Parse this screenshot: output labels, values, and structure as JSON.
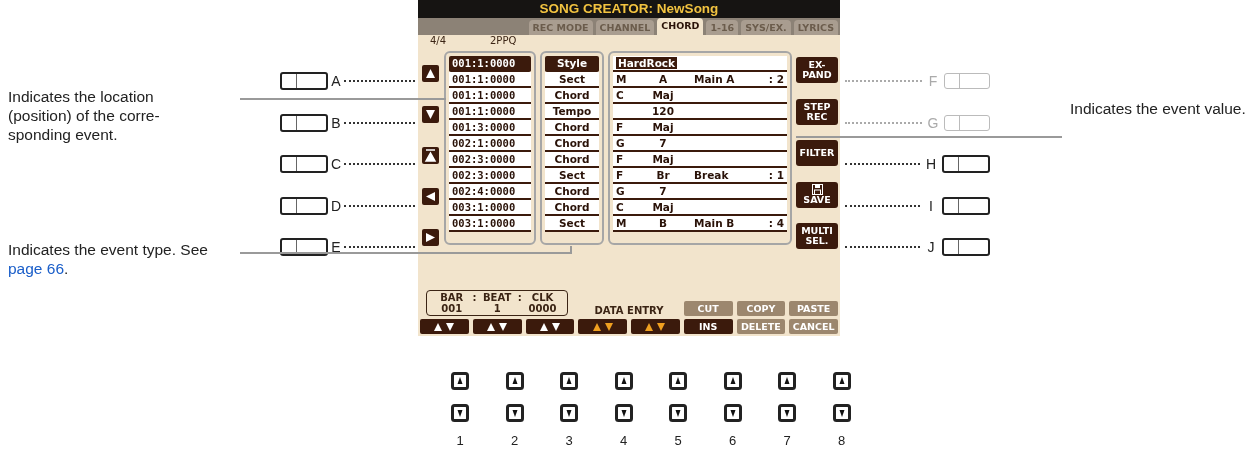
{
  "callouts": [
    {
      "lines": [
        "Indicates the location",
        "(position) of the corre-",
        "sponding event."
      ]
    },
    {
      "lines": [
        "Indicates the event type. See"
      ],
      "link": "page 66",
      "after": "."
    },
    {
      "lines": [
        "Indicates the event value."
      ]
    }
  ],
  "left_buttons": [
    {
      "letter": "A",
      "disabled": false
    },
    {
      "letter": "B",
      "disabled": false
    },
    {
      "letter": "C",
      "disabled": false
    },
    {
      "letter": "D",
      "disabled": false
    },
    {
      "letter": "E",
      "disabled": false
    }
  ],
  "right_buttons": [
    {
      "letter": "F",
      "disabled": true
    },
    {
      "letter": "G",
      "disabled": true
    },
    {
      "letter": "H",
      "disabled": false
    },
    {
      "letter": "I",
      "disabled": false
    },
    {
      "letter": "J",
      "disabled": false
    }
  ],
  "screen": {
    "title": "SONG CREATOR: NewSong",
    "tabs": [
      {
        "label": "REC MODE",
        "selected": false
      },
      {
        "label": "CHANNEL",
        "selected": false
      },
      {
        "label": "CHORD",
        "selected": true
      },
      {
        "label": "1-16",
        "selected": false
      },
      {
        "label": "SYS/EX.",
        "selected": false
      },
      {
        "label": "LYRICS",
        "selected": false
      }
    ],
    "time_signature": "4/4",
    "resolution": "2PPQ",
    "events": [
      {
        "position": "001:1:0000",
        "type": "Style",
        "style": "HardRock",
        "selected": true
      },
      {
        "position": "001:1:0000",
        "type": "Sect",
        "key": "M",
        "main": "A",
        "name": "Main A",
        "count": ": 2",
        "selected": false
      },
      {
        "position": "001:1:0000",
        "type": "Chord",
        "key": "C",
        "main": "Maj",
        "selected": false
      },
      {
        "position": "001:1:0000",
        "type": "Tempo",
        "main": "120",
        "selected": false
      },
      {
        "position": "001:3:0000",
        "type": "Chord",
        "key": "F",
        "main": "Maj",
        "selected": false
      },
      {
        "position": "002:1:0000",
        "type": "Chord",
        "key": "G",
        "main": "7",
        "selected": false
      },
      {
        "position": "002:3:0000",
        "type": "Chord",
        "key": "F",
        "main": "Maj",
        "selected": false
      },
      {
        "position": "002:3:0000",
        "type": "Sect",
        "key": "F",
        "main": "Br",
        "name": "Break",
        "count": ": 1",
        "selected": false
      },
      {
        "position": "002:4:0000",
        "type": "Chord",
        "key": "G",
        "main": "7",
        "selected": false
      },
      {
        "position": "003:1:0000",
        "type": "Chord",
        "key": "C",
        "main": "Maj",
        "selected": false
      },
      {
        "position": "003:1:0000",
        "type": "Sect",
        "key": "M",
        "main": "B",
        "name": "Main B",
        "count": ": 4",
        "selected": false
      }
    ],
    "side_buttons": [
      {
        "kind": "text",
        "lines": [
          "EX-",
          "PAND"
        ]
      },
      {
        "kind": "text",
        "lines": [
          "STEP",
          "REC"
        ]
      },
      {
        "kind": "text",
        "lines": [
          "FILTER"
        ]
      },
      {
        "kind": "save",
        "lines": [
          "SAVE"
        ]
      },
      {
        "kind": "text",
        "lines": [
          "MULTI",
          "SEL."
        ]
      }
    ],
    "position_box": {
      "labels": [
        "BAR",
        ":",
        "BEAT",
        ":",
        "CLK"
      ],
      "values": [
        "001",
        "1",
        "0000"
      ]
    },
    "data_entry_label": "DATA ENTRY",
    "lower_controls": [
      {
        "kind": "arrows",
        "accent": false
      },
      {
        "kind": "arrows",
        "accent": false
      },
      {
        "kind": "arrows",
        "accent": false
      },
      {
        "kind": "arrows",
        "accent": true
      },
      {
        "kind": "arrows",
        "accent": true
      },
      {
        "kind": "pair",
        "top": {
          "label": "CUT",
          "disabled": true
        },
        "bottom": {
          "label": "INS",
          "disabled": false
        }
      },
      {
        "kind": "pair",
        "top": {
          "label": "COPY",
          "disabled": true
        },
        "bottom": {
          "label": "DELETE",
          "disabled": true
        }
      },
      {
        "kind": "pair",
        "top": {
          "label": "PASTE",
          "disabled": true
        },
        "bottom": {
          "label": "CANCEL",
          "disabled": true
        }
      }
    ]
  },
  "panel_buttons": [
    {
      "label": "1"
    },
    {
      "label": "2"
    },
    {
      "label": "3"
    },
    {
      "label": "4"
    },
    {
      "label": "5"
    },
    {
      "label": "6"
    },
    {
      "label": "7"
    },
    {
      "label": "8"
    }
  ]
}
